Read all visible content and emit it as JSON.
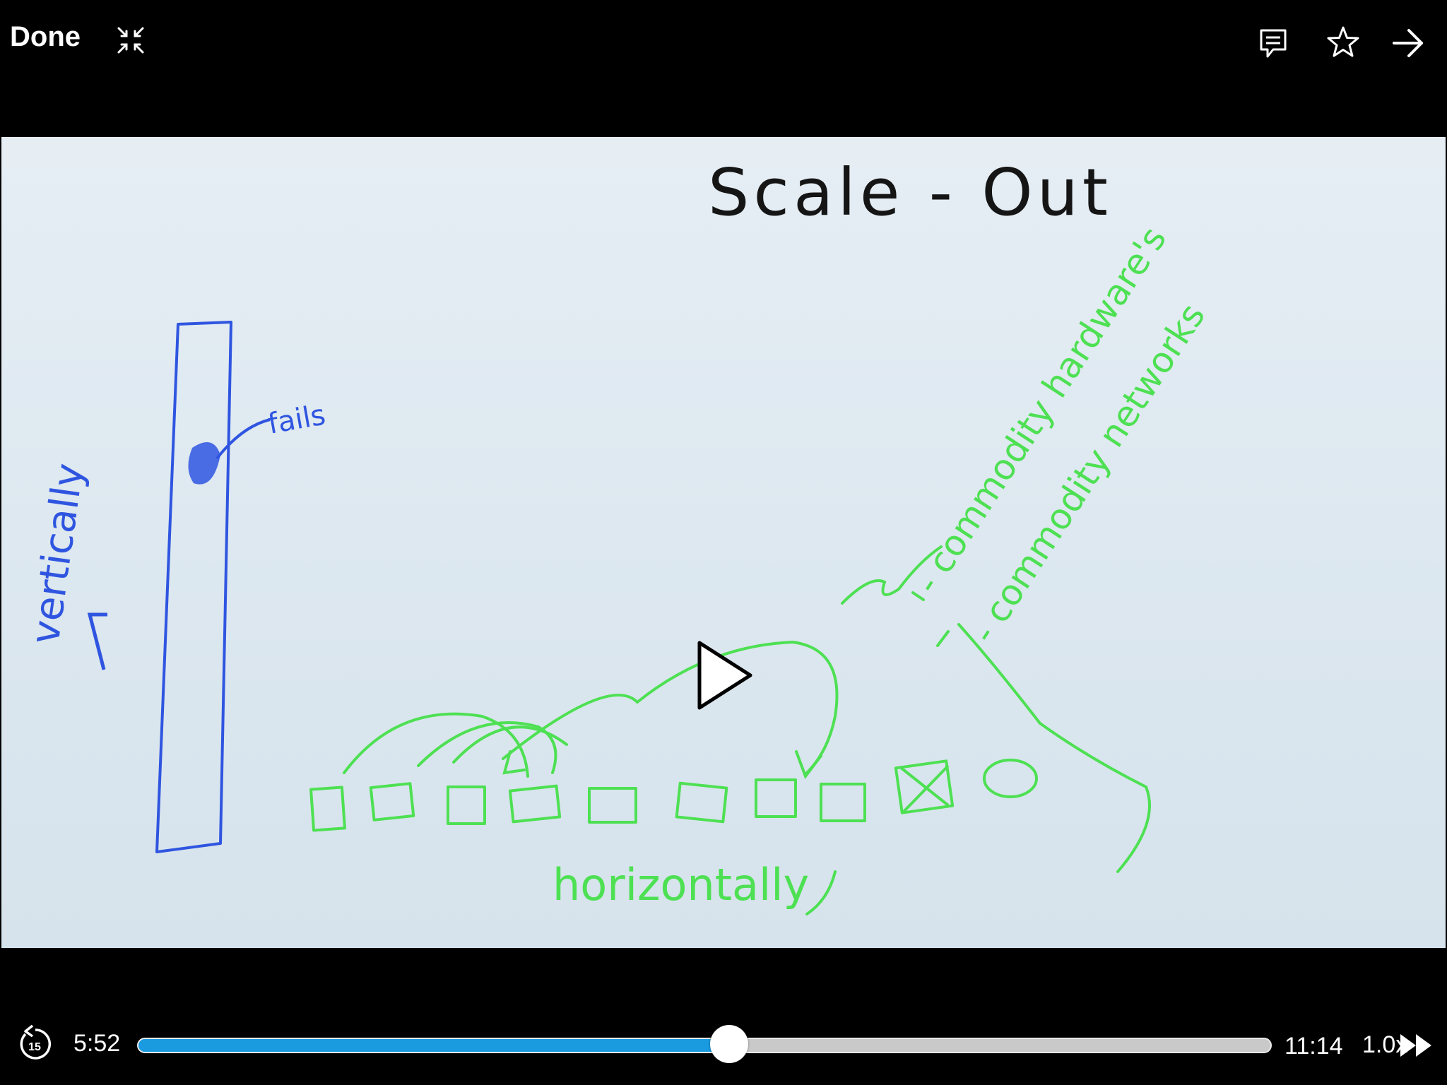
{
  "topbar": {
    "done_label": "Done",
    "icons": [
      "collapse-icon",
      "comment-icon",
      "star-icon",
      "arrow-right-icon"
    ]
  },
  "video": {
    "title_text": "Scale - Out",
    "annotations": {
      "vertically": "vertically",
      "fails": "fails",
      "horizontally": "horizontally",
      "commodity_hardware": "- commodity hardware's",
      "commodity_networks": "- commodity networks"
    },
    "play_icon": "play-icon"
  },
  "player": {
    "elapsed": "5:52",
    "duration": "11:14",
    "progress": 0.522,
    "speed_label": "1.0x",
    "skip_back_label": "15",
    "colors": {
      "progress_fill": "#1a9be0",
      "track": "#c9c9c9"
    }
  }
}
